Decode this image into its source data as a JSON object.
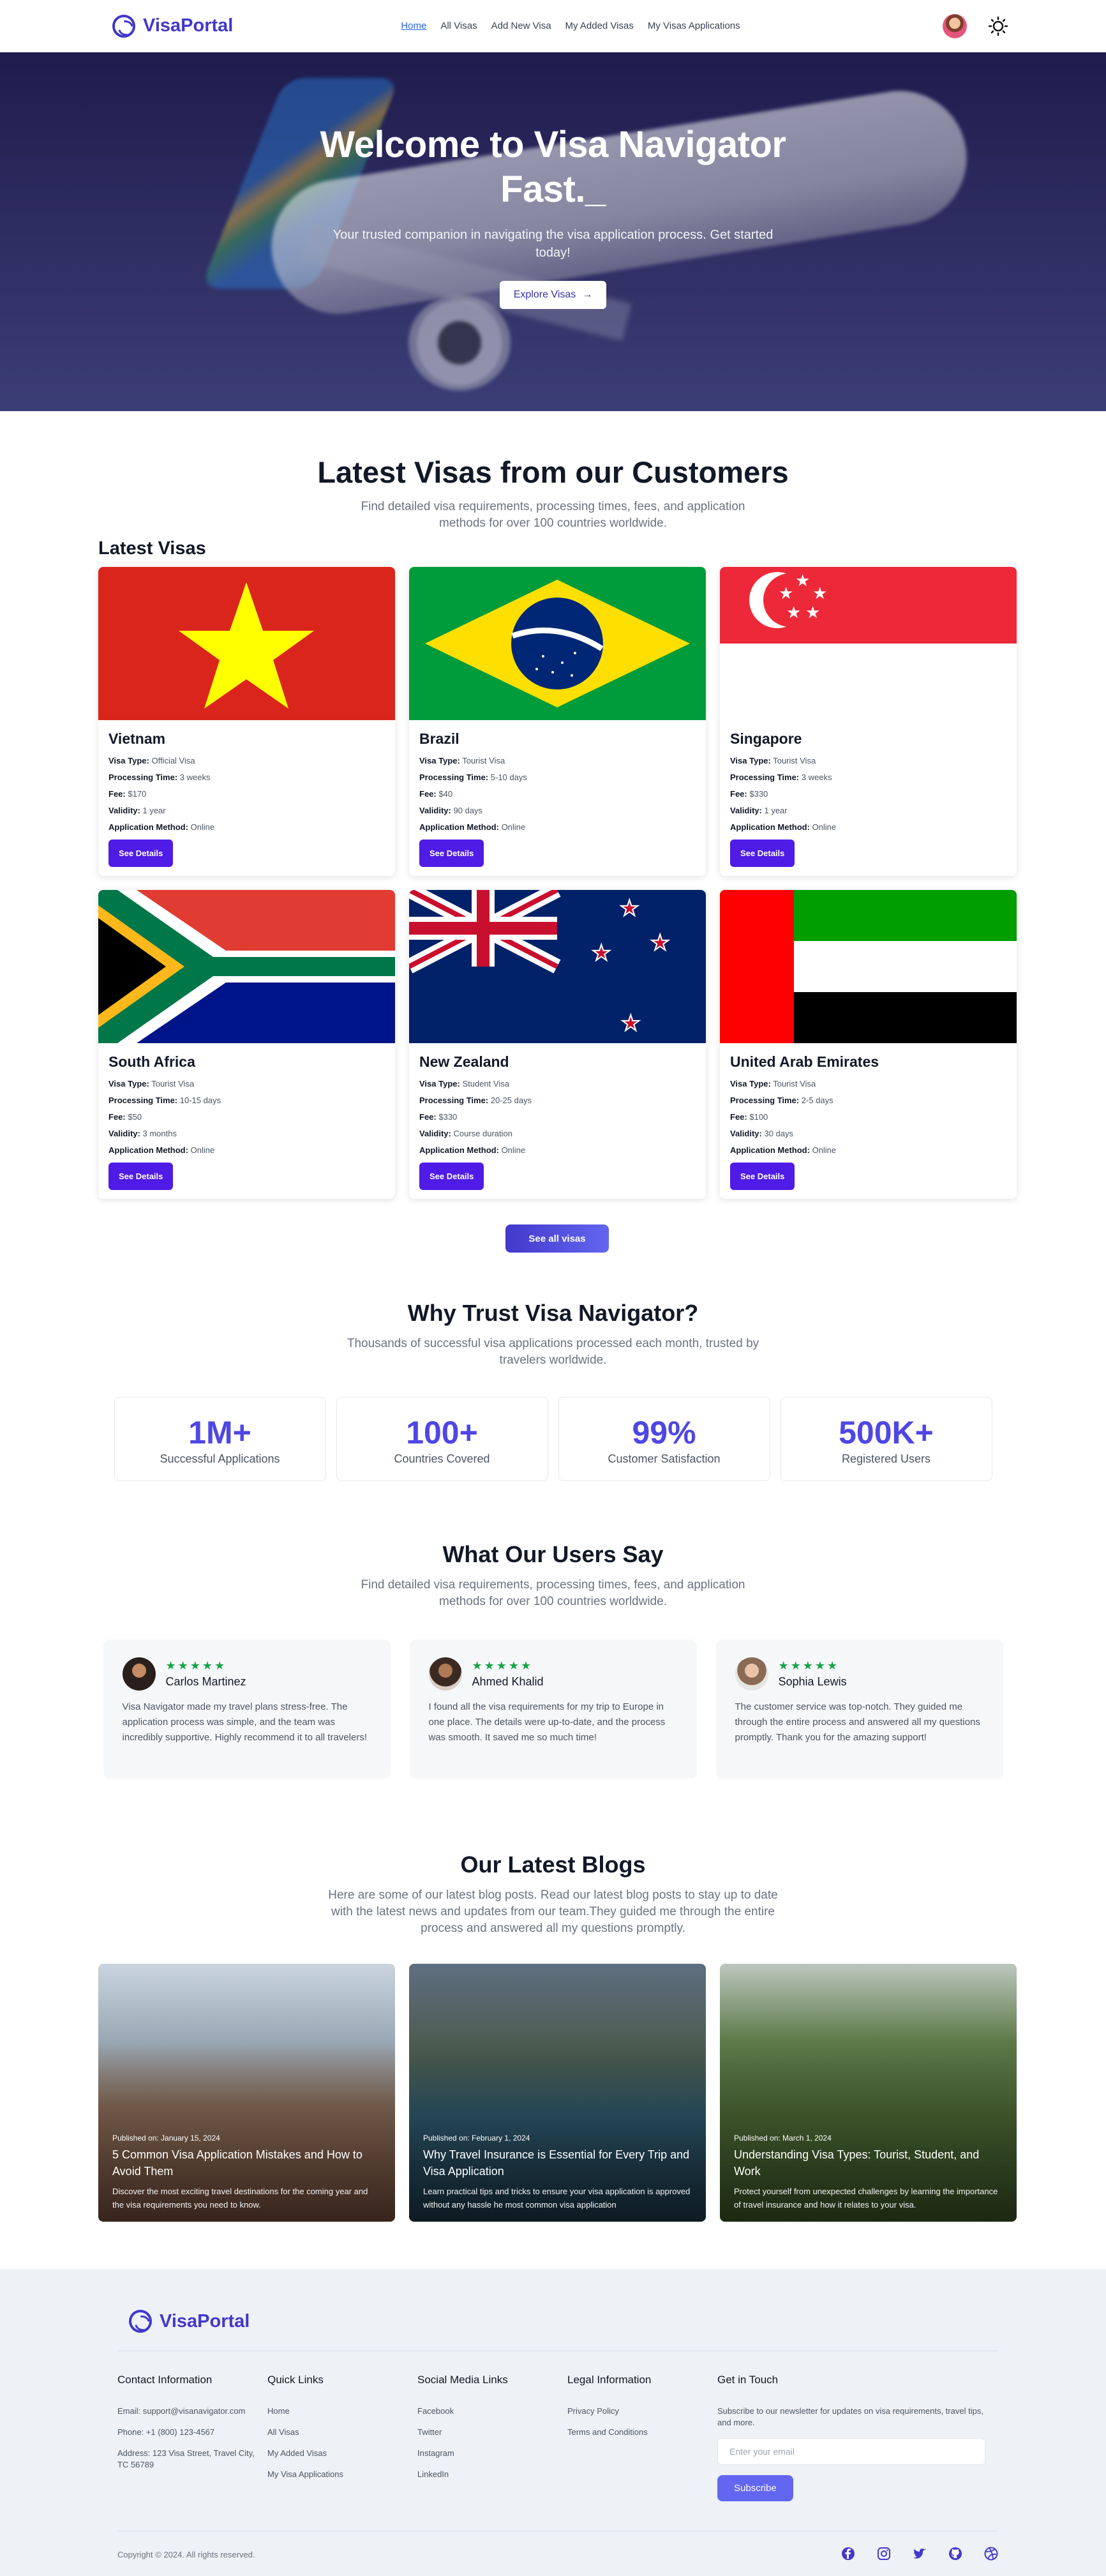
{
  "nav": {
    "brand": "VisaPortal",
    "links": [
      "Home",
      "All Visas",
      "Add New Visa",
      "My Added Visas",
      "My Visas Applications"
    ]
  },
  "hero": {
    "title_line1": "Welcome to Visa Navigator",
    "title_line2": "Fast._",
    "subtitle": "Your trusted companion in navigating the visa application process. Get started today!",
    "button": "Explore Visas",
    "button_icon": "→"
  },
  "latest": {
    "title": "Latest Visas from our Customers",
    "subtitle": "Find detailed visa requirements, processing times, fees, and application methods for over 100 countries worldwide.",
    "heading": "Latest Visas",
    "labels": {
      "type": "Visa Type:",
      "time": "Processing Time:",
      "fee": "Fee:",
      "validity": "Validity:",
      "method": "Application Method:"
    },
    "button": "See Details",
    "see_all": "See all visas",
    "cards": [
      {
        "country": "Vietnam",
        "type": "Official Visa",
        "time": "3 weeks",
        "fee": "$170",
        "validity": "1 year",
        "method": "Online"
      },
      {
        "country": "Brazil",
        "type": "Tourist Visa",
        "time": "5-10 days",
        "fee": "$40",
        "validity": "90 days",
        "method": "Online"
      },
      {
        "country": "Singapore",
        "type": "Tourist Visa",
        "time": "3 weeks",
        "fee": "$330",
        "validity": "1 year",
        "method": "Online"
      },
      {
        "country": "South Africa",
        "type": "Tourist Visa",
        "time": "10-15 days",
        "fee": "$50",
        "validity": "3 months",
        "method": "Online"
      },
      {
        "country": "New Zealand",
        "type": "Student Visa",
        "time": "20-25 days",
        "fee": "$330",
        "validity": "Course duration",
        "method": "Online"
      },
      {
        "country": "United Arab Emirates",
        "type": "Tourist Visa",
        "time": "2-5 days",
        "fee": "$100",
        "validity": "30 days",
        "method": "Online"
      }
    ]
  },
  "trust": {
    "title": "Why Trust Visa Navigator?",
    "subtitle": "Thousands of successful visa applications processed each month, trusted by travelers worldwide.",
    "stats": [
      {
        "value": "1M+",
        "label": "Successful Applications"
      },
      {
        "value": "100+",
        "label": "Countries Covered"
      },
      {
        "value": "99%",
        "label": "Customer Satisfaction"
      },
      {
        "value": "500K+",
        "label": "Registered Users"
      }
    ]
  },
  "testimonials": {
    "title": "What Our Users Say",
    "subtitle": "Find detailed visa requirements, processing times, fees, and application methods for over 100 countries worldwide.",
    "stars": "★★★★★",
    "items": [
      {
        "name": "Carlos Martinez",
        "text": "Visa Navigator made my travel plans stress-free. The application process was simple, and the team was incredibly supportive. Highly recommend it to all travelers!"
      },
      {
        "name": "Ahmed Khalid",
        "text": "I found all the visa requirements for my trip to Europe in one place. The details were up-to-date, and the process was smooth. It saved me so much time!"
      },
      {
        "name": "Sophia Lewis",
        "text": "The customer service was top-notch. They guided me through the entire process and answered all my questions promptly. Thank you for the amazing support!"
      }
    ]
  },
  "blogs": {
    "title": "Our Latest Blogs",
    "subtitle": "Here are some of our latest blog posts. Read our latest blog posts to stay up to date with the latest news and updates from our team.They guided me through the entire process and answered all my questions promptly.",
    "items": [
      {
        "date": "Published on: January 15, 2024",
        "title": "5 Common Visa Application Mistakes and How to Avoid Them",
        "desc": "Discover the most exciting travel destinations for the coming year and the visa requirements you need to know."
      },
      {
        "date": "Published on: February 1, 2024",
        "title": "Why Travel Insurance is Essential for Every Trip and Visa Application",
        "desc": "Learn practical tips and tricks to ensure your visa application is approved without any hassle he most common visa application"
      },
      {
        "date": "Published on: March 1, 2024",
        "title": "Understanding Visa Types: Tourist, Student, and Work",
        "desc": "Protect yourself from unexpected challenges by learning the importance of travel insurance and how it relates to your visa."
      }
    ]
  },
  "footer": {
    "brand": "VisaPortal",
    "contact": {
      "title": "Contact Information",
      "email": "Email: support@visanavigator.com",
      "phone": "Phone: +1 (800) 123-4567",
      "address": "Address: 123 Visa Street, Travel City, TC 56789"
    },
    "quick": {
      "title": "Quick Links",
      "items": [
        "Home",
        "All Visas",
        "My Added Visas",
        "My Visa Applications"
      ]
    },
    "social": {
      "title": "Social Media Links",
      "items": [
        "Facebook",
        "Twitter",
        "Instagram",
        "LinkedIn"
      ]
    },
    "legal": {
      "title": "Legal Information",
      "items": [
        "Privacy Policy",
        "Terms and Conditions"
      ]
    },
    "news": {
      "title": "Get in Touch",
      "text": "Subscribe to our newsletter for updates on visa requirements, travel tips, and more.",
      "placeholder": "Enter your email",
      "button": "Subscribe"
    },
    "copyright": "Copyright © 2024. All rights reserved.",
    "social_icons": [
      "facebook-icon",
      "instagram-icon",
      "twitter-icon",
      "github-icon",
      "dribbble-icon"
    ]
  }
}
